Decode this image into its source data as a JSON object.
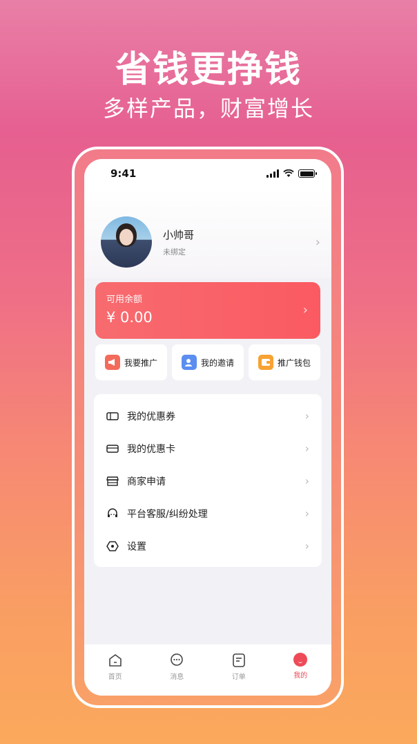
{
  "promo": {
    "headline": "省钱更挣钱",
    "subline": "多样产品，财富增长"
  },
  "status_bar": {
    "time": "9:41"
  },
  "profile": {
    "name": "小帅哥",
    "bind_status": "未绑定"
  },
  "balance": {
    "label": "可用余额",
    "amount": "¥ 0.00"
  },
  "quick_actions": [
    {
      "label": "我要推广",
      "icon": "megaphone-icon",
      "color": "#f36b5b"
    },
    {
      "label": "我的邀请",
      "icon": "user-invite-icon",
      "color": "#5b8ef0"
    },
    {
      "label": "推广钱包",
      "icon": "wallet-icon",
      "color": "#f7a233"
    }
  ],
  "menu": [
    {
      "label": "我的优惠券",
      "icon": "coupon-icon"
    },
    {
      "label": "我的优惠卡",
      "icon": "card-icon"
    },
    {
      "label": "商家申请",
      "icon": "store-icon"
    },
    {
      "label": "平台客服/纠纷处理",
      "icon": "headset-icon"
    },
    {
      "label": "设置",
      "icon": "settings-icon"
    }
  ],
  "tabs": [
    {
      "label": "首页",
      "icon": "home-icon",
      "active": false
    },
    {
      "label": "消息",
      "icon": "message-icon",
      "active": false
    },
    {
      "label": "订单",
      "icon": "order-icon",
      "active": false
    },
    {
      "label": "我的",
      "icon": "profile-icon",
      "active": true
    }
  ],
  "colors": {
    "accent": "#f95a62",
    "tab_active": "#e84b5a"
  }
}
